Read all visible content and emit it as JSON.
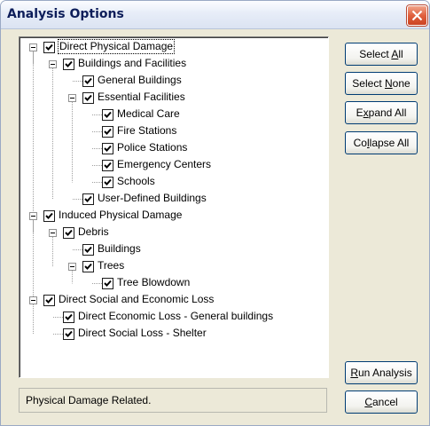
{
  "window": {
    "title": "Analysis Options"
  },
  "tree": [
    {
      "label": "Direct Physical Damage",
      "checked": true,
      "expandable": true,
      "level": 0
    },
    {
      "label": "Buildings and Facilities",
      "checked": true,
      "expandable": true,
      "level": 1
    },
    {
      "label": "General Buildings",
      "checked": true,
      "expandable": false,
      "level": 2
    },
    {
      "label": "Essential Facilities",
      "checked": true,
      "expandable": true,
      "level": 2
    },
    {
      "label": "Medical Care",
      "checked": true,
      "expandable": false,
      "level": 3
    },
    {
      "label": "Fire Stations",
      "checked": true,
      "expandable": false,
      "level": 3
    },
    {
      "label": "Police Stations",
      "checked": true,
      "expandable": false,
      "level": 3
    },
    {
      "label": "Emergency Centers",
      "checked": true,
      "expandable": false,
      "level": 3
    },
    {
      "label": "Schools",
      "checked": true,
      "expandable": false,
      "level": 3
    },
    {
      "label": "User-Defined Buildings",
      "checked": true,
      "expandable": false,
      "level": 2
    },
    {
      "label": "Induced Physical Damage",
      "checked": true,
      "expandable": true,
      "level": 0
    },
    {
      "label": "Debris",
      "checked": true,
      "expandable": true,
      "level": 1
    },
    {
      "label": "Buildings",
      "checked": true,
      "expandable": false,
      "level": 2
    },
    {
      "label": "Trees",
      "checked": true,
      "expandable": true,
      "level": 2
    },
    {
      "label": "Tree Blowdown",
      "checked": true,
      "expandable": false,
      "level": 3
    },
    {
      "label": "Direct Social and Economic Loss",
      "checked": true,
      "expandable": true,
      "level": 0
    },
    {
      "label": "Direct Economic Loss - General buildings",
      "checked": true,
      "expandable": false,
      "level": 1
    },
    {
      "label": "Direct Social Loss - Shelter",
      "checked": true,
      "expandable": false,
      "level": 1
    }
  ],
  "buttons": {
    "select_all": {
      "pre": "Select ",
      "key": "A",
      "post": "ll"
    },
    "select_none": {
      "pre": "Select ",
      "key": "N",
      "post": "one"
    },
    "expand_all": {
      "pre": "E",
      "key": "x",
      "post": "pand All"
    },
    "collapse_all": {
      "pre": "Co",
      "key": "l",
      "post": "lapse All"
    },
    "run_analysis": {
      "pre": "",
      "key": "R",
      "post": "un Analysis"
    },
    "cancel": {
      "pre": "",
      "key": "C",
      "post": "ancel"
    }
  },
  "status": {
    "text": "Physical Damage Related."
  },
  "icons": {
    "close": "close-icon",
    "checkbox": "checkmark-icon",
    "expander": "minus-expander-icon"
  }
}
